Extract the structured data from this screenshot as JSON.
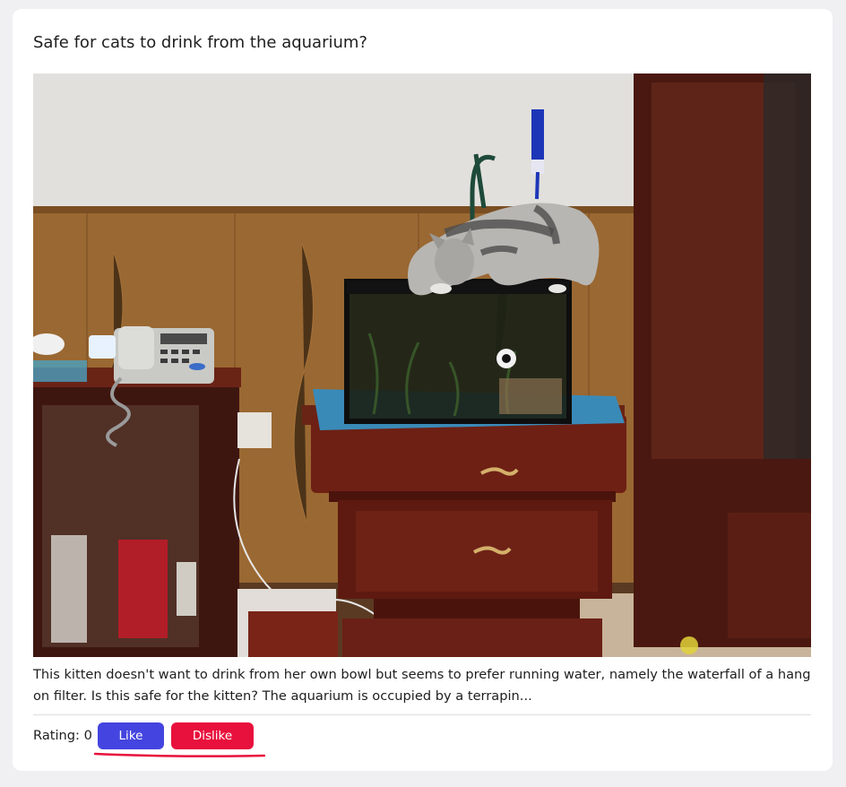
{
  "post": {
    "title": "Safe for cats to drink from the aquarium?",
    "body": "This kitten doesn't want to drink from her own bowl but seems to prefer running water, namely the waterfall of a hang on filter. Is this safe for the kitten? The aquarium is occupied by a terrapin...",
    "image_description": "photo",
    "rating_label": "Rating: 0"
  },
  "actions": {
    "like_label": "Like post",
    "dislike_label": "Dislike post"
  },
  "colors": {
    "like_button": "#4444e0",
    "dislike_button": "#e8103c",
    "underline": "#e8103c"
  }
}
